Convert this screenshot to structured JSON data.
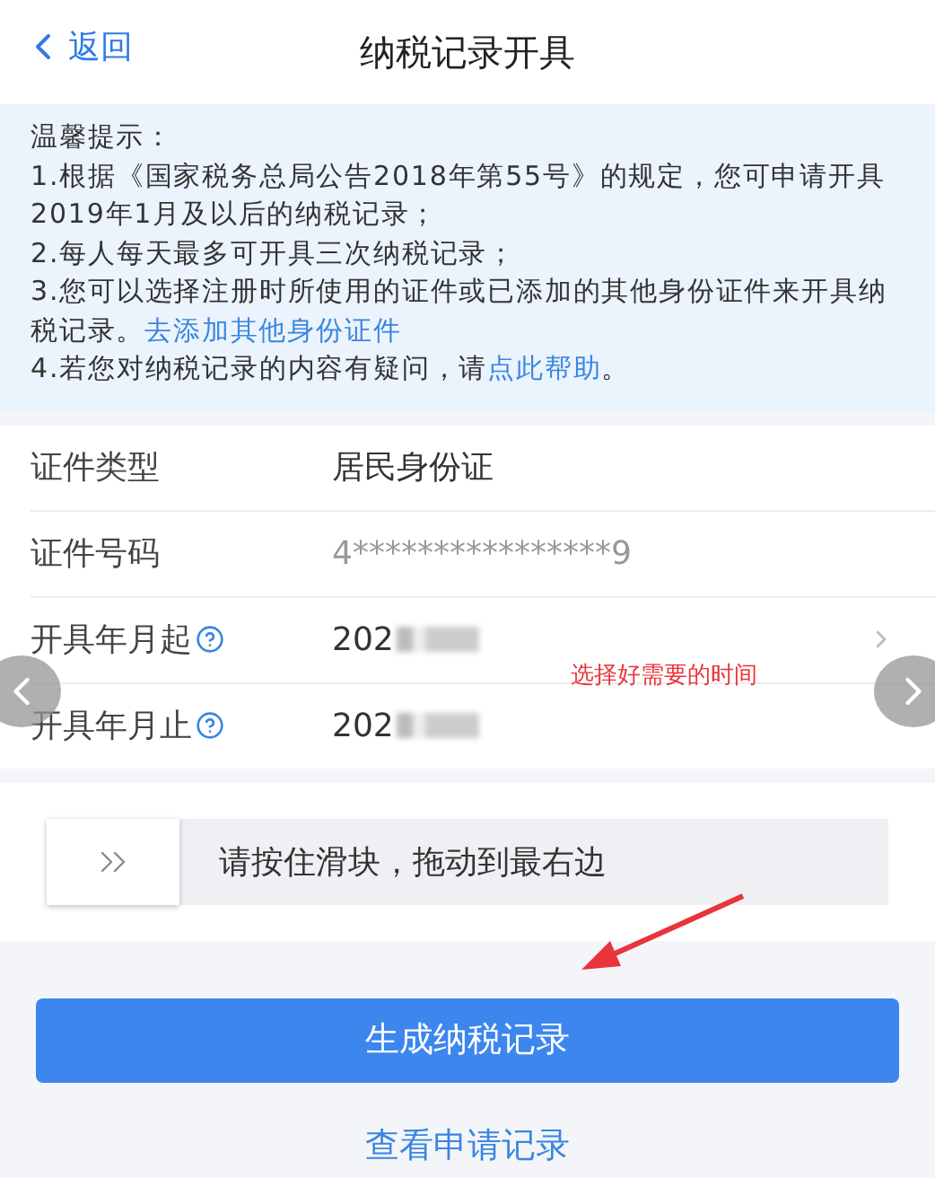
{
  "header": {
    "back_label": "返回",
    "title": "纳税记录开具"
  },
  "notice": {
    "title": "温馨提示：",
    "items": [
      {
        "text": "1.根据《国家税务总局公告2018年第55号》的规定，您可申请开具2019年1月及以后的纳税记录；"
      },
      {
        "text": "2.每人每天最多可开具三次纳税记录；"
      },
      {
        "text": "3.您可以选择注册时所使用的证件或已添加的其他身份证件来开具纳税记录。",
        "link": "去添加其他身份证件"
      },
      {
        "text": "4.若您对纳税记录的内容有疑问，请",
        "link": "点此帮助",
        "after": "。"
      }
    ]
  },
  "form": [
    {
      "label": "证件类型",
      "value": "居民身份证",
      "kind": "text"
    },
    {
      "label": "证件号码",
      "value": "4****************9",
      "kind": "masked"
    },
    {
      "label": "开具年月起",
      "value": "202",
      "kind": "date",
      "redacted": true,
      "help": true,
      "chevron": true
    },
    {
      "label": "开具年月止",
      "value": "202",
      "kind": "date",
      "redacted": true,
      "help": true,
      "chevron": false
    }
  ],
  "slider": {
    "hint": "请按住滑块，拖动到最右边"
  },
  "primary_button": "生成纳税记录",
  "link": "查看申请记录",
  "annotation": {
    "text": "选择好需要的时间"
  }
}
